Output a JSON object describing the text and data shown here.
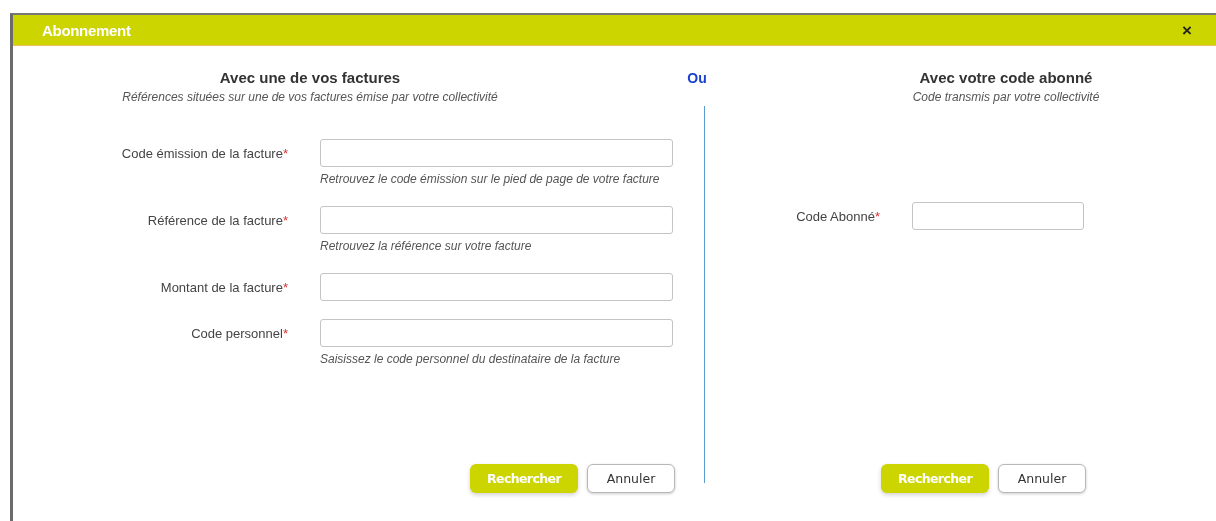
{
  "dialog": {
    "title": "Abonnement",
    "close": "×"
  },
  "left": {
    "title": "Avec une de vos factures",
    "subtitle": "Références situées sur une de vos factures émise par votre collectivité",
    "fields": [
      {
        "label": "Code émission de la facture",
        "mark": "*",
        "hint": "Retrouvez le code émission sur le pied de page de votre facture"
      },
      {
        "label": "Référence de la facture",
        "mark": "*",
        "hint": "Retrouvez la référence sur votre facture"
      },
      {
        "label": "Montant de la facture",
        "mark": "*"
      },
      {
        "label": "Code personnel",
        "mark": "*",
        "hint": "Saisissez le code personnel du destinataire de la facture"
      }
    ],
    "buttons": [
      {
        "label": "Rechercher",
        "kind": "primary"
      },
      {
        "label": "Annuler",
        "kind": "secondary"
      }
    ]
  },
  "separator": "Ou",
  "right": {
    "title": "Avec votre code abonné",
    "subtitle": "Code transmis par votre collectivité",
    "fields": [
      {
        "label": "Code Abonné",
        "mark": "*"
      }
    ],
    "buttons": [
      {
        "label": "Rechercher",
        "kind": "primary"
      },
      {
        "label": "Annuler",
        "kind": "secondary"
      }
    ]
  }
}
